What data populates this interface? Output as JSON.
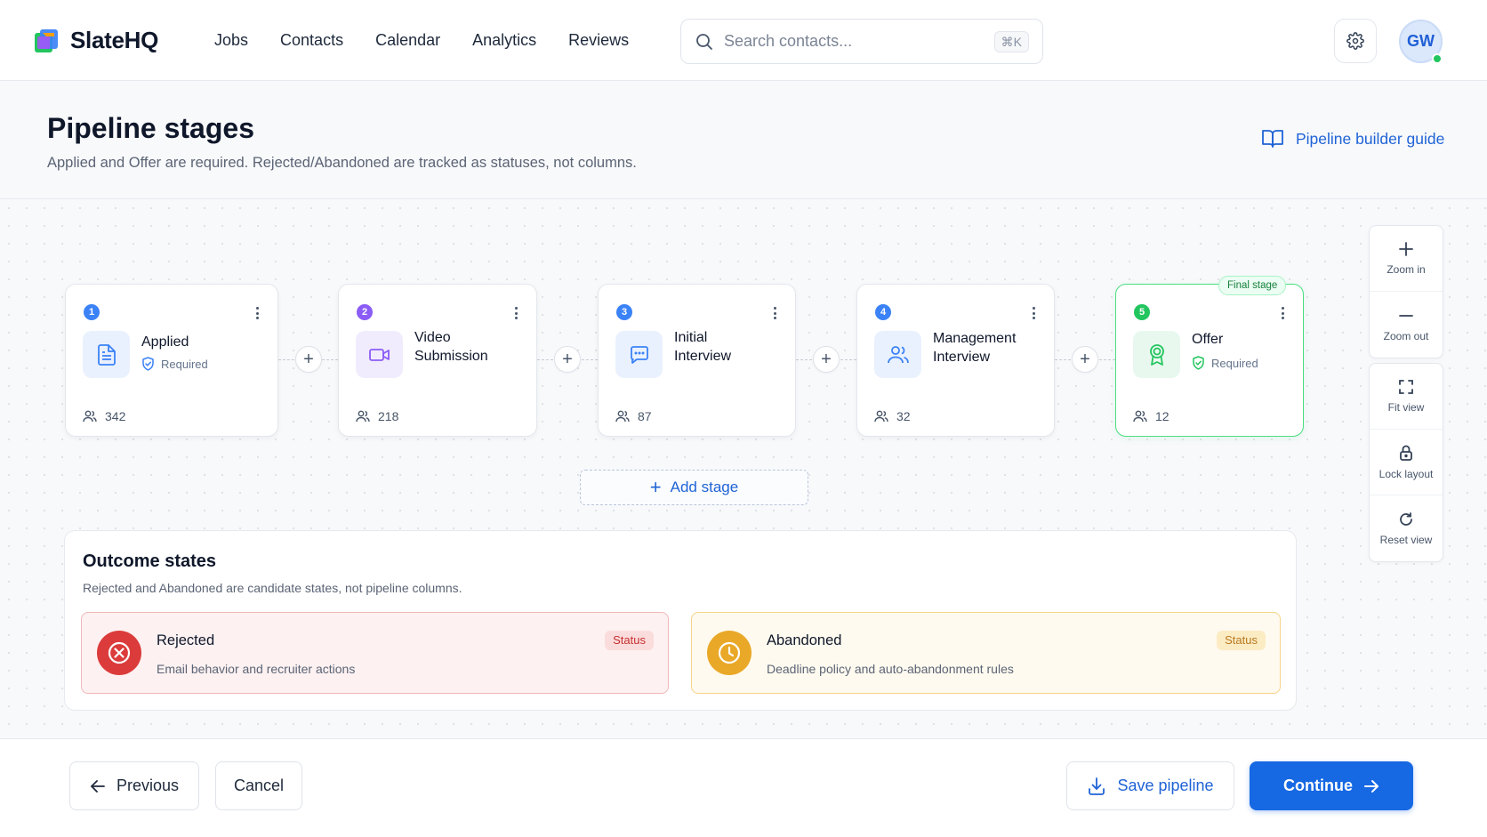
{
  "app": {
    "brand": "SlateHQ",
    "nav": [
      "Jobs",
      "Contacts",
      "Calendar",
      "Analytics",
      "Reviews"
    ],
    "search": {
      "placeholder": "Search contacts...",
      "shortcut": "⌘K"
    },
    "user_initials": "GW",
    "user_status": "online"
  },
  "page": {
    "title": "Pipeline stages",
    "subtitle": "Applied and Offer are required. Rejected/Abandoned are tracked as statuses, not columns.",
    "guide_link": "Pipeline builder guide"
  },
  "stages": [
    {
      "number": "1",
      "name_line1": "Applied",
      "name_line2": "",
      "required_label": "Required",
      "count": "342",
      "icon": "document-icon",
      "color": "#3b82f6"
    },
    {
      "number": "2",
      "name_line1": "Video",
      "name_line2": "Submission",
      "required_label": "",
      "count": "218",
      "icon": "video-icon",
      "color": "#8b5cf6"
    },
    {
      "number": "3",
      "name_line1": "Initial",
      "name_line2": "Interview",
      "required_label": "",
      "count": "87",
      "icon": "chat-icon",
      "color": "#3b82f6"
    },
    {
      "number": "4",
      "name_line1": "Management",
      "name_line2": "Interview",
      "required_label": "",
      "count": "32",
      "icon": "users-icon",
      "color": "#3b82f6"
    },
    {
      "number": "5",
      "name_line1": "Offer",
      "name_line2": "",
      "required_label": "Required",
      "count": "12",
      "icon": "award-icon",
      "color": "#22c55e",
      "badge": "Final stage"
    }
  ],
  "add_stage_label": "Add stage",
  "outcome": {
    "title": "Outcome states",
    "subtitle": "Rejected and Abandoned are candidate states, not pipeline columns.",
    "states": [
      {
        "name": "Rejected",
        "description": "Email behavior and recruiter actions",
        "badge": "Status",
        "color": "#dc3b3b"
      },
      {
        "name": "Abandoned",
        "description": "Deadline policy and auto-abandonment rules",
        "badge": "Status",
        "color": "#e9a827"
      }
    ]
  },
  "zoom_controls": [
    "Zoom in",
    "Zoom out",
    "Fit view",
    "Lock layout",
    "Reset view"
  ],
  "footer": {
    "previous": "Previous",
    "cancel": "Cancel",
    "save": "Save pipeline",
    "continue": "Continue"
  },
  "colors": {
    "accent": "#1668e3",
    "success": "#22c55e",
    "danger": "#dc3b3b",
    "warning": "#e9a827"
  }
}
